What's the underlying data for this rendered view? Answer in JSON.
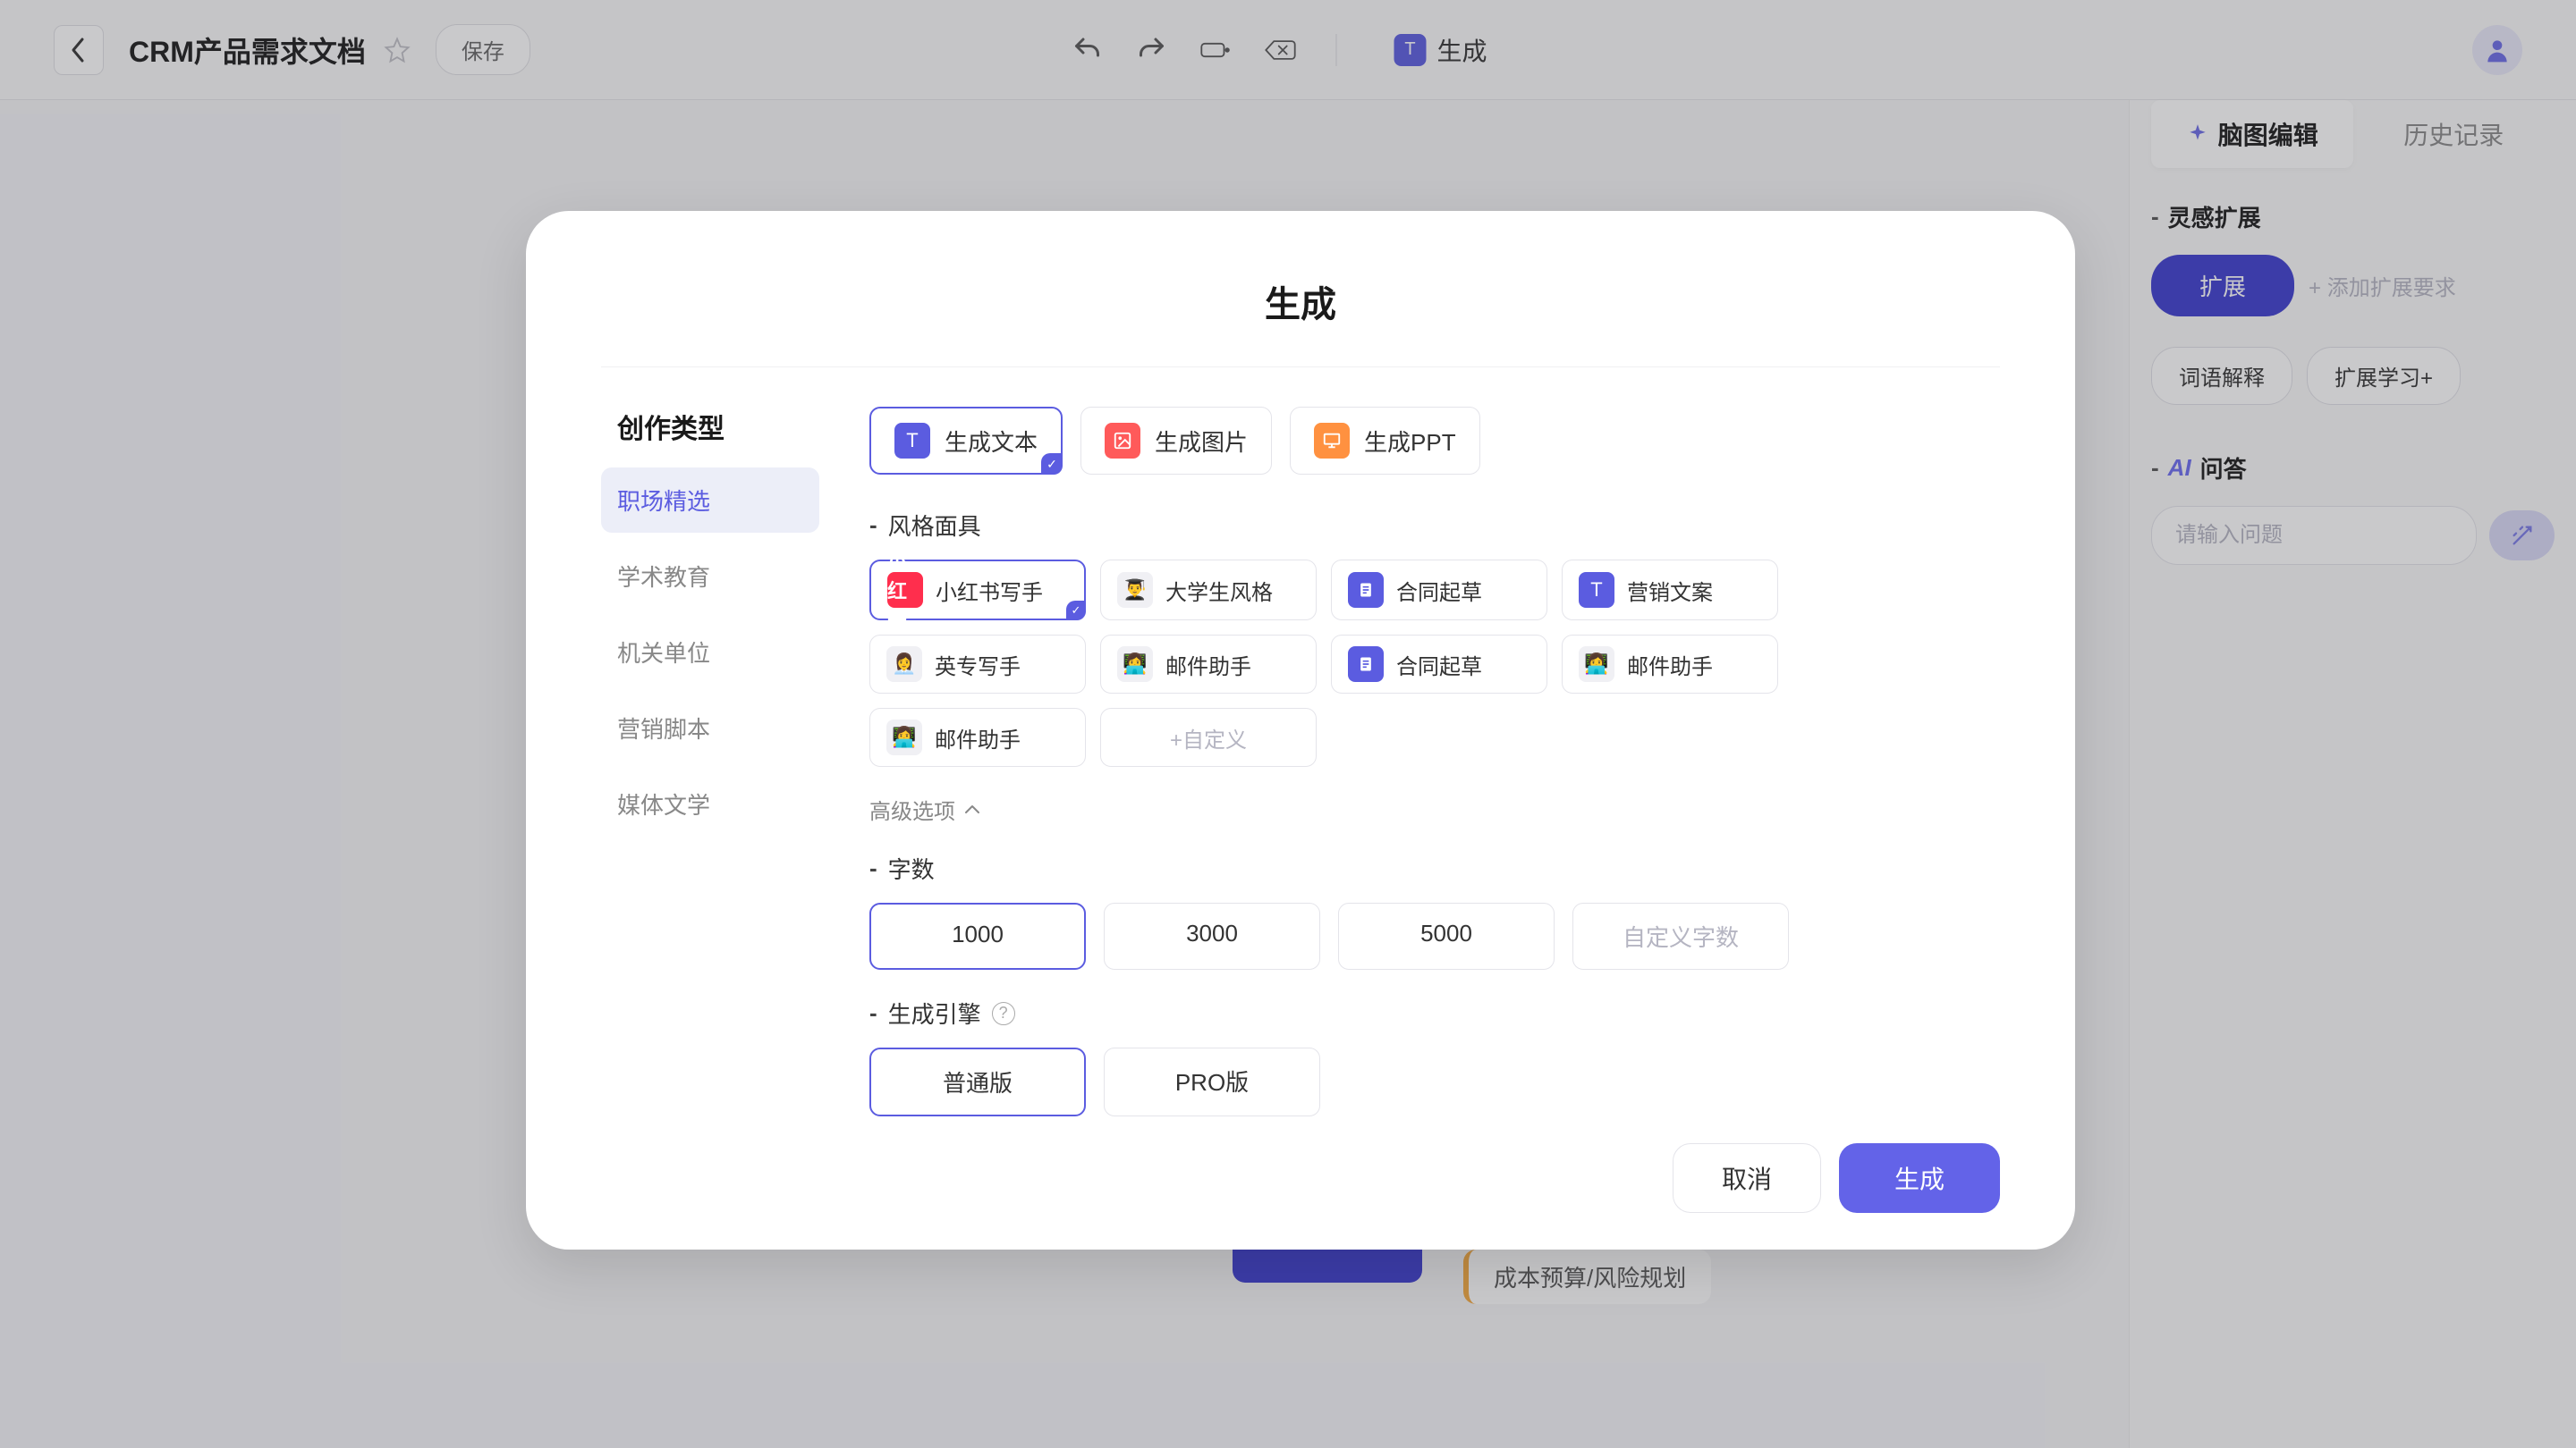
{
  "topbar": {
    "doc_title": "CRM产品需求文档",
    "save_label": "保存",
    "generate_label": "生成"
  },
  "right_panel": {
    "tabs": {
      "mindmap": "脑图编辑",
      "history": "历史记录"
    },
    "inspire": {
      "title": "灵感扩展",
      "expand_btn": "扩展",
      "add_hint": "+ 添加扩展要求"
    },
    "chips": {
      "explain": "词语解释",
      "learn": "扩展学习+"
    },
    "ai": {
      "title": "问答",
      "placeholder": "请输入问题"
    }
  },
  "background_nodes": {
    "cost_risk": "成本预算/风险规划"
  },
  "modal": {
    "title": "生成",
    "left_nav": {
      "title": "创作类型",
      "items": [
        "职场精选",
        "学术教育",
        "机关单位",
        "营销脚本",
        "媒体文学"
      ]
    },
    "type_options": [
      "生成文本",
      "生成图片",
      "生成PPT"
    ],
    "style": {
      "title": "风格面具",
      "items": [
        "小红书写手",
        "大学生风格",
        "合同起草",
        "营销文案",
        "英专写手",
        "邮件助手",
        "合同起草",
        "邮件助手",
        "邮件助手"
      ],
      "custom": "+自定义"
    },
    "advanced_toggle": "高级选项",
    "word_count": {
      "title": "字数",
      "options": [
        "1000",
        "3000",
        "5000"
      ],
      "custom": "自定义字数"
    },
    "engine": {
      "title": "生成引擎",
      "options": [
        "普通版",
        "PRO版"
      ]
    },
    "buttons": {
      "cancel": "取消",
      "confirm": "生成"
    }
  }
}
